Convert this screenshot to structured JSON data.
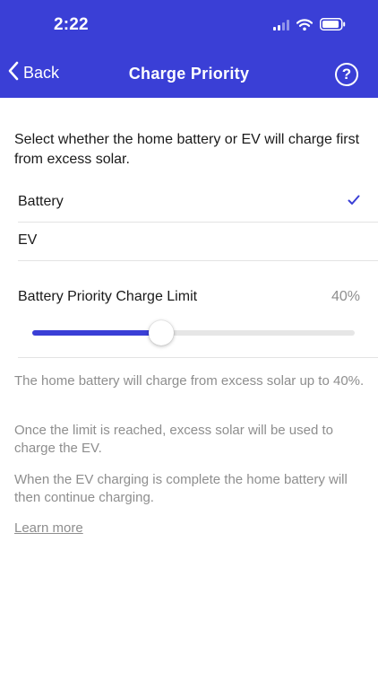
{
  "status_bar": {
    "time": "2:22",
    "icons": [
      "cellular-signal-icon",
      "wifi-icon",
      "battery-icon"
    ]
  },
  "nav": {
    "back_label": "Back",
    "title": "Charge Priority",
    "help_icon": "question-circle-icon",
    "help_glyph": "?"
  },
  "intro_text": "Select whether the home battery or EV will charge first from excess solar.",
  "options": [
    {
      "label": "Battery",
      "selected": true
    },
    {
      "label": "EV",
      "selected": false
    }
  ],
  "charge_limit": {
    "label": "Battery Priority Charge Limit",
    "value_text": "40%",
    "value_fraction": 0.4
  },
  "info": [
    "The home battery will charge from excess solar up to 40%.",
    "Once the limit is reached, excess solar will be used to charge the EV.",
    "When the EV charging is complete the home battery will then continue charging."
  ],
  "learn_more": "Learn more",
  "colors": {
    "accent": "#3a3fd6",
    "secondary_text": "#8e8e8e",
    "divider": "#e3e3e3"
  }
}
